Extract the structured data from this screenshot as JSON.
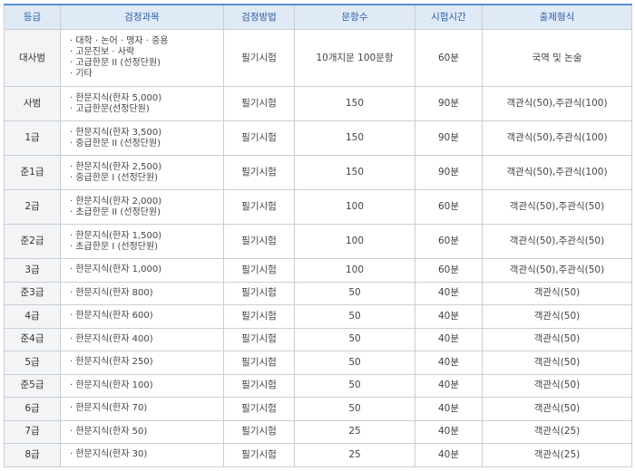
{
  "headers": [
    "등급",
    "검정과목",
    "검정방법",
    "문항수",
    "시험시간",
    "출제형식"
  ],
  "rows": [
    {
      "grade": "대사범",
      "subjects": [
        "· 대학 · 논어 · 맹자 · 중용",
        "· 고문진보 · 사략",
        "· 고급한문 II (선정단원)",
        "· 기타"
      ],
      "method": "필기시험",
      "questions": "10개지문 100문항",
      "time": "60분",
      "format": "국역 및 논술"
    },
    {
      "grade": "사범",
      "subjects": [
        "· 한문지식(한자 5,000)",
        "· 고급한문(선정단원)"
      ],
      "method": "필기시험",
      "questions": "150",
      "time": "90분",
      "format": "객관식(50),주관식(100)"
    },
    {
      "grade": "1급",
      "subjects": [
        "· 한문지식(한자 3,500)",
        "· 중급한문 II (선정단원)"
      ],
      "method": "필기시험",
      "questions": "150",
      "time": "90분",
      "format": "객관식(50),주관식(100)"
    },
    {
      "grade": "준1급",
      "subjects": [
        "· 한문지식(한자 2,500)",
        "· 중급한문 I (선정단원)"
      ],
      "method": "필기시험",
      "questions": "150",
      "time": "90분",
      "format": "객관식(50),주관식(100)"
    },
    {
      "grade": "2급",
      "subjects": [
        "· 한문지식(한자 2,000)",
        "· 초급한문 II (선정단원)"
      ],
      "method": "필기시험",
      "questions": "100",
      "time": "60분",
      "format": "객관식(50),주관식(50)"
    },
    {
      "grade": "준2급",
      "subjects": [
        "· 한문지식(한자 1,500)",
        "· 초급한문 I (선정단원)"
      ],
      "method": "필기시험",
      "questions": "100",
      "time": "60분",
      "format": "객관식(50),주관식(50)"
    },
    {
      "grade": "3급",
      "subjects": [
        "· 한문지식(한자 1,000)"
      ],
      "method": "필기시험",
      "questions": "100",
      "time": "60분",
      "format": "객관식(50),주관식(50)"
    },
    {
      "grade": "준3급",
      "subjects": [
        "· 한문지식(한자 800)"
      ],
      "method": "필기시험",
      "questions": "50",
      "time": "40분",
      "format": "객관식(50)"
    },
    {
      "grade": "4급",
      "subjects": [
        "· 한문지식(한자 600)"
      ],
      "method": "필기시험",
      "questions": "50",
      "time": "40분",
      "format": "객관식(50)"
    },
    {
      "grade": "준4급",
      "subjects": [
        "· 한문지식(한자 400)"
      ],
      "method": "필기시험",
      "questions": "50",
      "time": "40분",
      "format": "객관식(50)"
    },
    {
      "grade": "5급",
      "subjects": [
        "· 한문지식(한자 250)"
      ],
      "method": "필기시험",
      "questions": "50",
      "time": "40분",
      "format": "객관식(50)"
    },
    {
      "grade": "준5급",
      "subjects": [
        "· 한문지식(한자 100)"
      ],
      "method": "필기시험",
      "questions": "50",
      "time": "40분",
      "format": "객관식(50)"
    },
    {
      "grade": "6급",
      "subjects": [
        "· 한문지식(한자 70)"
      ],
      "method": "필기시험",
      "questions": "50",
      "time": "40분",
      "format": "객관식(50)"
    },
    {
      "grade": "7급",
      "subjects": [
        "· 한문지식(한자 50)"
      ],
      "method": "필기시험",
      "questions": "25",
      "time": "40분",
      "format": "객관식(25)"
    },
    {
      "grade": "8급",
      "subjects": [
        "· 한문지식(한자 30)"
      ],
      "method": "필기시험",
      "questions": "25",
      "time": "40분",
      "format": "객관식(25)"
    }
  ],
  "colors": {
    "header_bg": "#dfeaf6",
    "header_text": "#2b5fa4",
    "header_border": "#5b8fcf",
    "grade_bg": "#f3f4f6",
    "grid": "#c9ced6"
  }
}
